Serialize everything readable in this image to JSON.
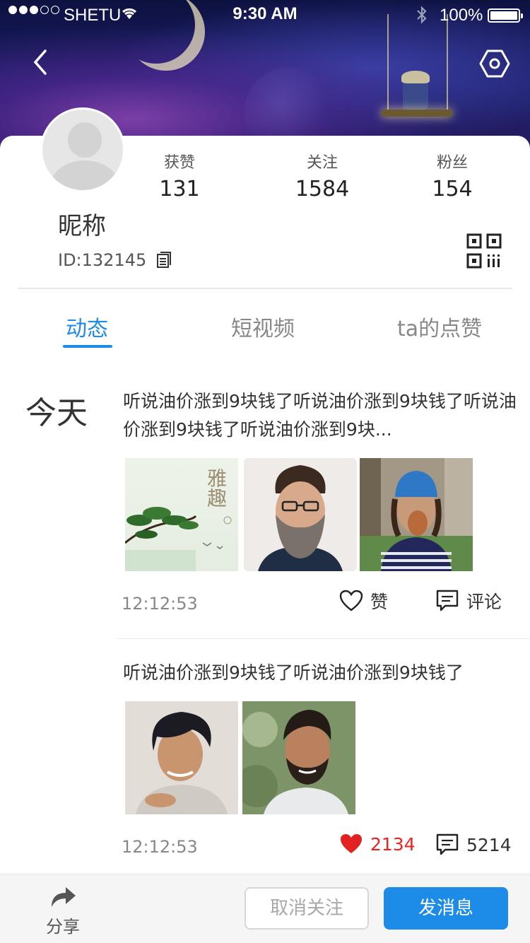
{
  "status_bar": {
    "carrier": "SHETU",
    "time": "9:30 AM",
    "battery": "100%"
  },
  "profile": {
    "nickname": "昵称",
    "id_text": "ID:132145",
    "stats": [
      {
        "label": "获赞",
        "value": "131"
      },
      {
        "label": "关注",
        "value": "1584"
      },
      {
        "label": "粉丝",
        "value": "154"
      }
    ]
  },
  "tabs": [
    {
      "label": "动态",
      "active": true
    },
    {
      "label": "短视频",
      "active": false
    },
    {
      "label": "ta的点赞",
      "active": false
    }
  ],
  "feed": {
    "day_label": "今天",
    "posts": [
      {
        "text": "听说油价涨到9块钱了听说油价涨到9块钱了听说油价涨到9块钱了听说油价涨到9块...",
        "time": "12:12:53",
        "like_label": "赞",
        "comment_label": "评论",
        "images": [
          "ink-painting-art",
          "bearded-man-portrait",
          "girl-blue-beanie-portrait"
        ],
        "art_text": "雅趣"
      },
      {
        "text": "听说油价涨到9块钱了听说油价涨到9块钱了",
        "time": "12:12:53",
        "like_count": "2134",
        "comment_count": "5214",
        "images": [
          "young-man-portrait",
          "smiling-bearded-man-portrait"
        ]
      }
    ]
  },
  "bottom_bar": {
    "share_label": "分享",
    "unfollow_label": "取消关注",
    "message_label": "发消息"
  },
  "colors": {
    "accent": "#1d8be8",
    "like_red": "#e22222",
    "muted": "#888888"
  }
}
